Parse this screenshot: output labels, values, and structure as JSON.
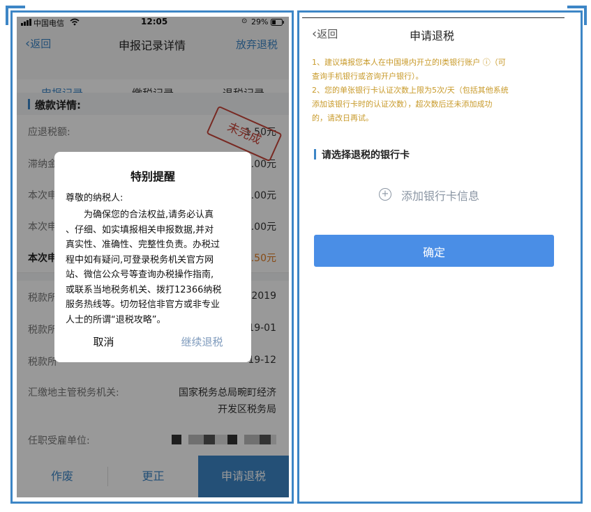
{
  "left": {
    "status": {
      "carrier": "中国电信",
      "time": "12:05",
      "battery": "29%"
    },
    "nav": {
      "back": "返回",
      "title": "申报记录详情",
      "action": "放弃退税"
    },
    "tabs": [
      "申报记录",
      "缴税记录",
      "退税记录"
    ],
    "section": "缴款详情:",
    "stamp": "未完成",
    "rows": [
      {
        "label": "应退税额:",
        "value": "1.50元"
      },
      {
        "label": "滞纳金",
        "value": "0.00元"
      },
      {
        "label": "本次申",
        "value": "0.00元"
      },
      {
        "label": "本次申",
        "value": "0.00元"
      },
      {
        "label": "本次申",
        "value": "1.50元"
      },
      {
        "label": "税款所",
        "value": "2019"
      },
      {
        "label": "税款所",
        "value": "19-01"
      },
      {
        "label": "税款所",
        "value": "19-12"
      }
    ],
    "authority": {
      "label": "汇缴地主管税务机关:",
      "value_line1": "国家税务总局畹町经济",
      "value_line2": "开发区税务局"
    },
    "employer": {
      "label": "任职受雇单位:"
    },
    "bottom": {
      "void": "作废",
      "correct": "更正",
      "apply": "申请退税"
    },
    "dialog": {
      "title": "特别提醒",
      "greeting": "尊敬的纳税人:",
      "lines": [
        "为确保您的合法权益,请务必认真",
        "、仔细、如实填报相关申报数据,并对",
        "真实性、准确性、完整性负责。办税过",
        "程中如有疑问,可登录税务机关官方网",
        "站、微信公众号等查询办税操作指南,",
        "或联系当地税务机关、拨打12366纳税",
        "服务热线等。切勿轻信非官方或非专业",
        "人士的所谓“退税攻略”。"
      ],
      "cancel": "取消",
      "continue": "继续退税"
    }
  },
  "right": {
    "nav": {
      "back": "返回",
      "title": "申请退税"
    },
    "notice_lines": [
      "1、建议填报您本人在中国境内开立的Ⅰ类银行账户 ⓘ（可",
      "查询手机银行或咨询开户银行）。",
      "2、您的单张银行卡认证次数上限为5次/天（包括其他系统",
      "添加该银行卡时的认证次数），超次数后还未添加成功",
      "的，请改日再试。"
    ],
    "section": "请选择退税的银行卡",
    "add_card": "添加银行卡信息",
    "confirm": "确定"
  },
  "colors": {
    "accent": "#3d86c6",
    "notice": "#c89a2a",
    "confirm": "#4a8ee6",
    "stamp": "#c8453a"
  }
}
